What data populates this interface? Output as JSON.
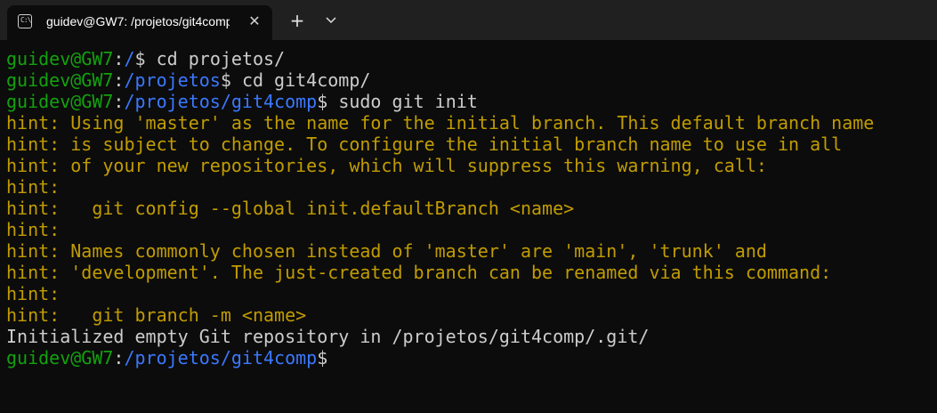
{
  "tab": {
    "title": "guidev@GW7: /projetos/git4comp",
    "icon": "terminal-icon",
    "icon_glyph": "C:\\",
    "close_glyph": "✕"
  },
  "toolbar": {
    "new_tab_glyph": "+",
    "dropdown_icon": "chevron-down-icon"
  },
  "colors": {
    "background": "#0c0c0c",
    "user": "#13a10e",
    "path": "#3b78ff",
    "hint": "#c19c00",
    "text": "#cccccc"
  },
  "terminal": {
    "lines": [
      {
        "kind": "prompt",
        "user": "guidev@GW7",
        "sep": ":",
        "path": "/",
        "dollar": "$ ",
        "command": "cd projetos/"
      },
      {
        "kind": "prompt",
        "user": "guidev@GW7",
        "sep": ":",
        "path": "/projetos",
        "dollar": "$ ",
        "command": "cd git4comp/"
      },
      {
        "kind": "prompt",
        "user": "guidev@GW7",
        "sep": ":",
        "path": "/projetos/git4comp",
        "dollar": "$ ",
        "command": "sudo git init"
      },
      {
        "kind": "hint",
        "text": "hint: Using 'master' as the name for the initial branch. This default branch name"
      },
      {
        "kind": "hint",
        "text": "hint: is subject to change. To configure the initial branch name to use in all"
      },
      {
        "kind": "hint",
        "text": "hint: of your new repositories, which will suppress this warning, call:"
      },
      {
        "kind": "hint",
        "text": "hint:"
      },
      {
        "kind": "hint",
        "text": "hint:   git config --global init.defaultBranch <name>"
      },
      {
        "kind": "hint",
        "text": "hint:"
      },
      {
        "kind": "hint",
        "text": "hint: Names commonly chosen instead of 'master' are 'main', 'trunk' and"
      },
      {
        "kind": "hint",
        "text": "hint: 'development'. The just-created branch can be renamed via this command:"
      },
      {
        "kind": "hint",
        "text": "hint:"
      },
      {
        "kind": "hint",
        "text": "hint:   git branch -m <name>"
      },
      {
        "kind": "output",
        "text": "Initialized empty Git repository in /projetos/git4comp/.git/"
      },
      {
        "kind": "prompt",
        "user": "guidev@GW7",
        "sep": ":",
        "path": "/projetos/git4comp",
        "dollar": "$",
        "command": ""
      }
    ]
  }
}
